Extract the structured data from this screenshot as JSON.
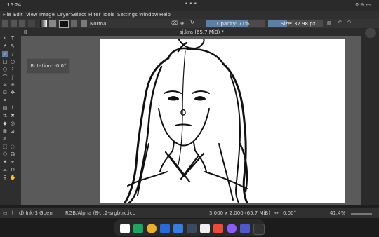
{
  "statusbar": {
    "time": "16:24",
    "dots": "•••",
    "right": "⚲ ⊖ ▭"
  },
  "menu": [
    "File",
    "Edit",
    "View",
    "Image",
    "Layer",
    "Select",
    "Filter",
    "Tools",
    "Settings",
    "Window",
    "Help"
  ],
  "toolbar": {
    "blend_mode": "Normal",
    "opacity_label": "Opacity: 71%",
    "opacity_value": 71,
    "size_label": "Size: 32.98 px",
    "size_fraction": 0.35
  },
  "document": {
    "tab_title": "sj.kra (65.7 MiB) *"
  },
  "overlay": {
    "rotation": "Rotation: -0.0°"
  },
  "bottom": {
    "brush": "d) Ink-3 Gpen",
    "color_profile": "RGB/Alpha (8-...2-srgbtrc.icc",
    "dimensions": "3,000 x 2,000 (65.7 MiB)",
    "rotation": "0.00°",
    "zoom": "41.4%"
  },
  "dock_apps": [
    "google-app",
    "drive-app",
    "chrome-app",
    "files-app",
    "docs-app",
    "v3-app",
    "notion-app",
    "photos-app",
    "messenger-app",
    "teams-app",
    "launcher-app"
  ],
  "colors": {
    "accent": "#5e7ea4",
    "canvas": "#ffffff",
    "viewport": "#5a5a5a"
  }
}
